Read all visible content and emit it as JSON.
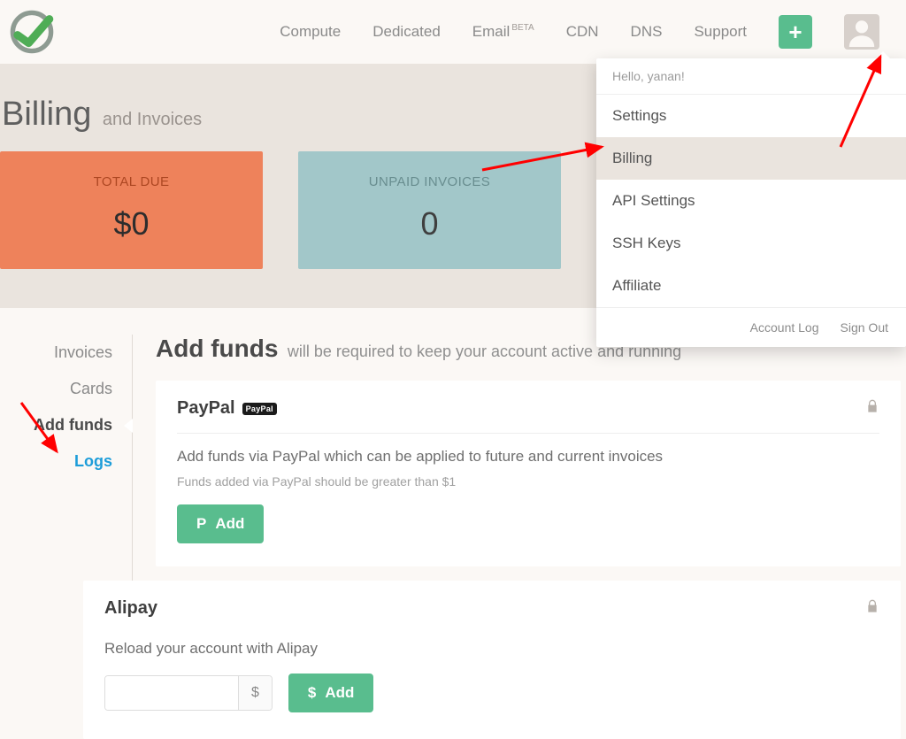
{
  "nav": {
    "compute": "Compute",
    "dedicated": "Dedicated",
    "email": "Email",
    "email_badge": "BETA",
    "cdn": "CDN",
    "dns": "DNS",
    "support": "Support"
  },
  "dropdown": {
    "hello": "Hello, yanan!",
    "settings": "Settings",
    "billing": "Billing",
    "api": "API Settings",
    "ssh": "SSH Keys",
    "affiliate": "Affiliate",
    "account_log": "Account Log",
    "sign_out": "Sign Out"
  },
  "page": {
    "title": "Billing",
    "subtitle": "and Invoices"
  },
  "stats": {
    "total_due_label": "TOTAL DUE",
    "total_due_value": "$0",
    "unpaid_label": "UNPAID INVOICES",
    "unpaid_value": "0"
  },
  "tabs": {
    "invoices": "Invoices",
    "cards": "Cards",
    "add_funds": "Add funds",
    "logs": "Logs"
  },
  "main": {
    "title": "Add funds",
    "desc": "will be required to keep your account active and running"
  },
  "paypal": {
    "title": "PayPal",
    "badge": "PayPal",
    "desc": "Add funds via PayPal which can be applied to future and current invoices",
    "sub": "Funds added via PayPal should be greater than $1",
    "btn": "Add"
  },
  "alipay": {
    "title": "Alipay",
    "desc": "Reload your account with Alipay",
    "currency": "$",
    "btn": "Add"
  }
}
